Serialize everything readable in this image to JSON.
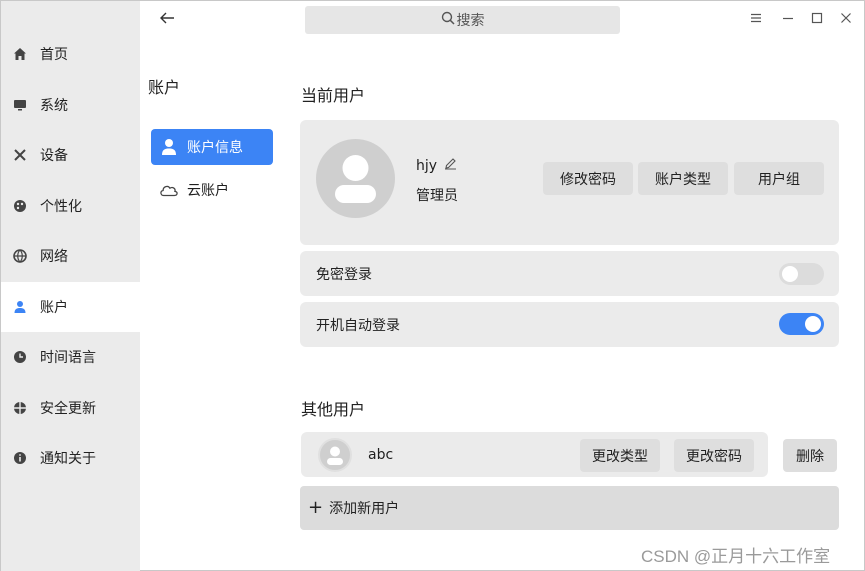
{
  "titlebar": {
    "search_placeholder": "搜索"
  },
  "nav": {
    "items": [
      {
        "label": "首页",
        "icon": "home-icon"
      },
      {
        "label": "系统",
        "icon": "monitor-icon"
      },
      {
        "label": "设备",
        "icon": "tools-icon"
      },
      {
        "label": "个性化",
        "icon": "palette-icon"
      },
      {
        "label": "网络",
        "icon": "globe-icon"
      },
      {
        "label": "账户",
        "icon": "user-icon",
        "active": true
      },
      {
        "label": "时间语言",
        "icon": "clock-icon"
      },
      {
        "label": "安全更新",
        "icon": "shield-icon"
      },
      {
        "label": "通知关于",
        "icon": "info-icon"
      }
    ]
  },
  "accounts": {
    "title": "账户",
    "items": [
      {
        "label": "账户信息",
        "icon": "user-icon",
        "active": true
      },
      {
        "label": "云账户",
        "icon": "cloud-icon"
      }
    ]
  },
  "current_user": {
    "section_title": "当前用户",
    "name": "hjy",
    "role": "管理员",
    "buttons": {
      "change_password": "修改密码",
      "account_type": "账户类型",
      "user_group": "用户组"
    },
    "passwordless_login": {
      "label": "免密登录",
      "enabled": false
    },
    "auto_login": {
      "label": "开机自动登录",
      "enabled": true
    }
  },
  "other_users": {
    "section_title": "其他用户",
    "users": [
      {
        "name": "abc",
        "change_type": "更改类型",
        "change_password": "更改密码",
        "delete": "删除"
      }
    ],
    "add_user": "添加新用户"
  },
  "colors": {
    "accent": "#3c84f5",
    "card_bg": "#ebebeb",
    "nav_bg": "#ebebeb"
  },
  "watermark": "CSDN @正月十六工作室"
}
